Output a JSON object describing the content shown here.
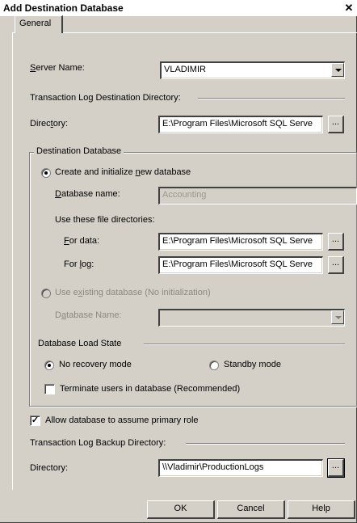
{
  "window": {
    "title": "Add Destination Database",
    "close_glyph": "✕"
  },
  "tabs": [
    {
      "label": "General",
      "selected": true
    }
  ],
  "server": {
    "label_accel": "S",
    "label_rest": "erver Name:",
    "value": "VLADIMIR"
  },
  "tlog_dest": {
    "section_label": "Transaction Log Destination Directory:",
    "label_pre": "Direc",
    "label_accel": "t",
    "label_post": "ory:",
    "value": "E:\\Program Files\\Microsoft SQL Serve",
    "browse_label": "..."
  },
  "dest_db": {
    "group_label": "Destination Database",
    "create_pre": "Create and initialize ",
    "create_accel": "n",
    "create_post": "ew database",
    "create_checked": true,
    "dbname_accel": "D",
    "dbname_rest": "atabase name:",
    "dbname_value": "Accounting",
    "file_dirs_label": "Use these file directories:",
    "data_accel": "F",
    "data_rest": "or data:",
    "data_value": "E:\\Program Files\\Microsoft SQL Serve",
    "log_pre": "For ",
    "log_accel": "l",
    "log_post": "og:",
    "log_value": "E:\\Program Files\\Microsoft SQL Serve",
    "browse_label": "...",
    "existing_pre": "Use e",
    "existing_accel": "x",
    "existing_post": "isting database (No initialization)",
    "existing_checked": false,
    "existing_dbname_pre": "D",
    "existing_dbname_accel": "a",
    "existing_dbname_post": "tabase Name:",
    "existing_dbname_value": ""
  },
  "load_state": {
    "section_label": "Database Load State",
    "no_recovery_label": "No recovery mode",
    "no_recovery_checked": true,
    "standby_label": "Standby mode",
    "standby_checked": false,
    "terminate_label": "Terminate users in database (Recommended)",
    "terminate_checked": false
  },
  "primary_role": {
    "label": "Allow database to assume primary role",
    "checked": true
  },
  "backup": {
    "section_label": "Transaction Log Backup Directory:",
    "label": "Directory:",
    "value": "\\\\Vladimir\\ProductionLogs",
    "browse_label": "..."
  },
  "buttons": {
    "ok": "OK",
    "cancel": "Cancel",
    "help": "Help"
  }
}
